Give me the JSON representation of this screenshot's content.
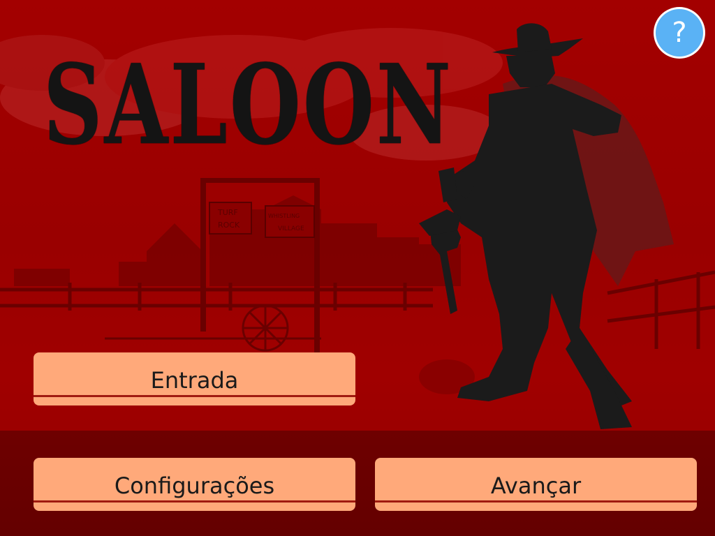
{
  "app": {
    "title": "SALOON"
  },
  "menu": {
    "entrada_label": "Entrada",
    "configuracoes_label": "Configurações",
    "avancar_label": "Avançar"
  },
  "help": {
    "label": "?",
    "icon": "question-mark-icon"
  },
  "background": {
    "sign_left_line1": "TURF",
    "sign_left_line2": "ROCK",
    "sign_right_line1": "WHISTLING",
    "sign_right_line2": "VILLAGE"
  },
  "colors": {
    "background_red": "#a30000",
    "bottom_band": "#6e0000",
    "button_fill": "#ffa97a",
    "button_stripe": "#a01a10",
    "help_blue": "#5ab2f5",
    "silhouette": "#1b1b1b"
  }
}
